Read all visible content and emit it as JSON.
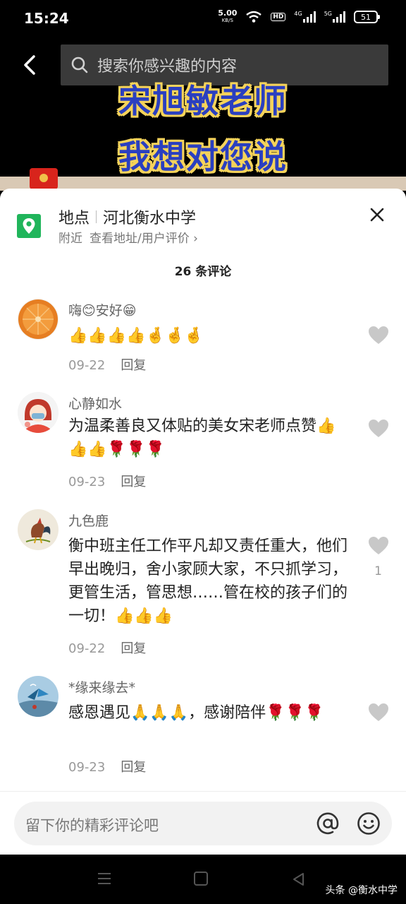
{
  "status": {
    "time": "15:24",
    "net_speed": "5.00",
    "net_unit": "KB/S",
    "hd": "HD",
    "sig1_label": "4G",
    "sig2_label": "5G",
    "battery": "51"
  },
  "search": {
    "placeholder": "搜索你感兴趣的内容"
  },
  "video_overlay": {
    "line1": "宋旭敏老师",
    "line2": "我想对您说"
  },
  "location": {
    "label": "地点",
    "name": "河北衡水中学",
    "sub_near": "附近",
    "sub_link": "查看地址/用户评价 ›"
  },
  "comment_count": "26 条评论",
  "comments": [
    {
      "name": "嗨😊安好😁",
      "text": "👍👍👍👍🤞🤞🤞",
      "date": "09-22",
      "reply": "回复",
      "likes": ""
    },
    {
      "name": "心静如水",
      "text": "为温柔善良又体贴的美女宋老师点赞👍👍👍🌹🌹🌹",
      "date": "09-23",
      "reply": "回复",
      "likes": ""
    },
    {
      "name": "九色鹿",
      "text": "衡中班主任工作平凡却又责任重大，他们早出晚归，舍小家顾大家，不只抓学习，更管生活，管思想……管在校的孩子们的一切！👍👍👍",
      "date": "09-22",
      "reply": "回复",
      "likes": "1"
    },
    {
      "name": "*缘来缘去*",
      "text": "感恩遇见🙏🙏🙏，感谢陪伴🌹🌹🌹",
      "date": "09-23",
      "reply": "回复",
      "likes": ""
    }
  ],
  "input": {
    "placeholder": "留下你的精彩评论吧"
  },
  "watermark": "头条 @衡水中学",
  "colors": {
    "location_green": "#20b55b",
    "overlay_blue": "#2a3fc0",
    "overlay_yellow": "#f5d35a"
  }
}
